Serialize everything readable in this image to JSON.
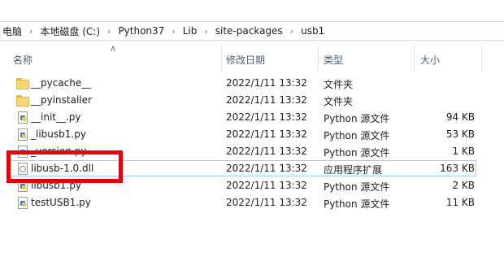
{
  "breadcrumb": [
    "电脑",
    "本地磁盘 (C:)",
    "Python37",
    "Lib",
    "site-packages",
    "usb1"
  ],
  "columns": {
    "name": "名称",
    "date": "修改日期",
    "type": "类型",
    "size": "大小"
  },
  "files": [
    {
      "name": "__pycache__",
      "date": "2022/1/11 13:32",
      "type": "文件夹",
      "size": "",
      "icon": "folder-icon"
    },
    {
      "name": "__pyinstaller",
      "date": "2022/1/11 13:32",
      "type": "文件夹",
      "size": "",
      "icon": "folder-icon"
    },
    {
      "name": "__init__.py",
      "date": "2022/1/11 13:32",
      "type": "Python 源文件",
      "size": "94 KB",
      "icon": "python-file-icon"
    },
    {
      "name": "_libusb1.py",
      "date": "2022/1/11 13:32",
      "type": "Python 源文件",
      "size": "53 KB",
      "icon": "python-file-icon"
    },
    {
      "name": "_version.py",
      "date": "2022/1/11 13:32",
      "type": "Python 源文件",
      "size": "1 KB",
      "icon": "python-file-icon"
    },
    {
      "name": "libusb-1.0.dll",
      "date": "2022/1/11 13:32",
      "type": "应用程序扩展",
      "size": "163 KB",
      "icon": "dll-file-icon"
    },
    {
      "name": "libusb1.py",
      "date": "2022/1/11 13:32",
      "type": "Python 源文件",
      "size": "2 KB",
      "icon": "python-file-icon"
    },
    {
      "name": "testUSB1.py",
      "date": "2022/1/11 13:32",
      "type": "Python 源文件",
      "size": "11 KB",
      "icon": "python-file-icon"
    }
  ],
  "colors": {
    "annotation": "#e8000b",
    "selection_border": "#99d1ff",
    "header_text": "#4c607a"
  }
}
